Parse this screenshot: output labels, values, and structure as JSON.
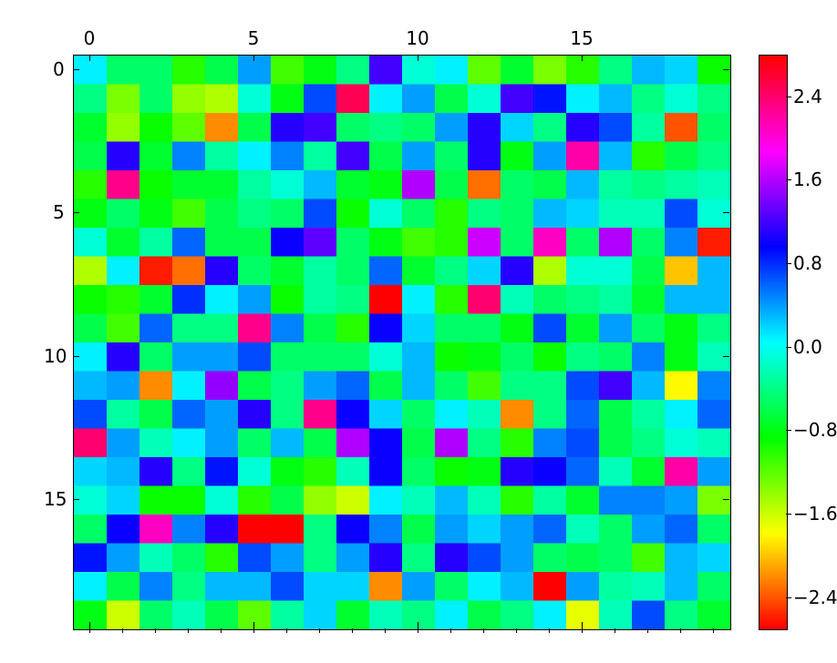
{
  "chart_data": {
    "type": "heatmap",
    "title": "",
    "xlabel": "",
    "ylabel": "",
    "x_ticks": [
      0,
      5,
      10,
      15
    ],
    "y_ticks": [
      0,
      5,
      10,
      15
    ],
    "colorbar_ticks": [
      -2.4,
      -1.6,
      -0.8,
      0.0,
      0.8,
      1.6,
      2.4
    ],
    "vmin": -2.7,
    "vmax": 2.8,
    "n_rows": 20,
    "n_cols": 20,
    "colormap": "hsv",
    "tick_labels": {
      "x0": "0",
      "x5": "5",
      "x10": "10",
      "x15": "15",
      "y0": "0",
      "y5": "5",
      "y10": "10",
      "y15": "15",
      "cb_m24": "−2.4",
      "cb_m16": "−1.6",
      "cb_m08": "−0.8",
      "cb_00": "0.0",
      "cb_08": "0.8",
      "cb_16": "1.6",
      "cb_24": "2.4"
    },
    "values": [
      [
        0.1,
        -0.5,
        -0.5,
        -1.0,
        -0.6,
        0.4,
        -1.1,
        -0.8,
        -0.4,
        1.2,
        -0.1,
        0.1,
        -1.2,
        -0.7,
        -1.3,
        -1.0,
        -0.4,
        0.3,
        0.2,
        -0.9
      ],
      [
        -0.4,
        -1.3,
        -0.5,
        -1.4,
        -1.5,
        -0.1,
        -0.8,
        0.7,
        2.5,
        0.1,
        0.4,
        -0.6,
        -0.1,
        1.2,
        0.9,
        0.1,
        0.3,
        -0.4,
        -0.1,
        -0.4
      ],
      [
        -0.7,
        -1.4,
        -0.9,
        -1.2,
        -2.2,
        -0.6,
        1.1,
        1.2,
        -0.5,
        -0.4,
        -0.5,
        0.4,
        1.1,
        0.2,
        -0.4,
        1.1,
        0.7,
        -0.3,
        -2.4,
        -0.5
      ],
      [
        -0.6,
        1.1,
        -0.7,
        0.5,
        -0.3,
        0.1,
        0.5,
        -0.3,
        1.2,
        -0.6,
        0.4,
        -0.5,
        1.1,
        -0.8,
        0.4,
        2.2,
        0.3,
        -1.0,
        -0.6,
        -0.4
      ],
      [
        -1.0,
        2.3,
        -0.9,
        -0.7,
        -0.7,
        -0.3,
        -0.1,
        0.3,
        -0.7,
        -0.8,
        1.6,
        -0.6,
        -2.3,
        -0.5,
        -0.6,
        0.3,
        -0.3,
        -0.4,
        -0.3,
        -0.2
      ],
      [
        -0.8,
        -0.5,
        -0.8,
        -1.1,
        -0.6,
        -0.4,
        -0.5,
        0.7,
        -0.9,
        -0.1,
        -0.5,
        -1.0,
        -0.4,
        -0.5,
        0.3,
        0.2,
        -0.2,
        -0.2,
        0.7,
        -0.1
      ],
      [
        -0.1,
        -0.7,
        -0.3,
        0.6,
        -0.6,
        -0.6,
        1.0,
        1.3,
        -0.5,
        -0.8,
        -1.1,
        -1.0,
        1.7,
        -0.5,
        2.1,
        -0.5,
        1.6,
        -0.5,
        0.5,
        -2.6
      ],
      [
        -1.5,
        0.1,
        -2.6,
        -2.3,
        1.1,
        -0.5,
        -0.7,
        -0.3,
        -0.5,
        0.6,
        -0.7,
        -0.4,
        0.2,
        1.1,
        -1.5,
        -0.1,
        -0.1,
        -0.6,
        -2.0,
        0.3
      ],
      [
        -0.9,
        -1.0,
        -0.7,
        0.8,
        0.1,
        0.4,
        -0.9,
        -0.3,
        -0.4,
        2.8,
        0.1,
        -1.0,
        2.4,
        -0.2,
        -0.5,
        -0.4,
        -0.3,
        -0.7,
        0.3,
        0.3
      ],
      [
        -0.6,
        -1.1,
        0.6,
        -0.4,
        -0.4,
        2.3,
        0.5,
        -0.6,
        -1.0,
        1.0,
        0.2,
        -0.5,
        -0.5,
        -0.8,
        0.7,
        -0.7,
        0.4,
        -0.5,
        -0.8,
        -0.4
      ],
      [
        0.1,
        1.1,
        -0.5,
        0.4,
        0.4,
        0.7,
        -0.5,
        -0.5,
        -0.5,
        -0.1,
        0.3,
        -0.9,
        -0.8,
        -0.5,
        -0.9,
        -0.4,
        -0.5,
        0.5,
        -0.8,
        -0.2
      ],
      [
        0.3,
        0.4,
        -2.2,
        0.1,
        1.5,
        -0.6,
        -0.4,
        0.4,
        0.6,
        -0.6,
        0.3,
        -0.5,
        -1.1,
        -0.4,
        -0.4,
        0.7,
        1.2,
        0.3,
        -1.8,
        0.5
      ],
      [
        0.7,
        -0.3,
        -0.6,
        0.6,
        0.4,
        1.1,
        -0.4,
        2.3,
        1.0,
        0.2,
        -0.5,
        0.1,
        -0.2,
        -2.2,
        -0.4,
        0.6,
        -0.6,
        -0.3,
        0.1,
        0.6
      ],
      [
        2.4,
        0.4,
        -0.2,
        0.1,
        0.4,
        -0.5,
        0.3,
        -0.6,
        1.6,
        1.0,
        -0.6,
        1.6,
        -0.4,
        -1.0,
        0.5,
        0.7,
        -0.6,
        -0.4,
        -0.1,
        -0.2
      ],
      [
        0.2,
        0.3,
        1.1,
        -0.4,
        0.9,
        -0.1,
        -0.8,
        -1.0,
        -0.2,
        1.0,
        -0.5,
        -0.9,
        -0.8,
        1.1,
        1.0,
        0.6,
        -0.2,
        -0.7,
        2.2,
        0.4
      ],
      [
        -0.1,
        0.2,
        -0.9,
        -0.9,
        -0.1,
        -1.0,
        -0.6,
        -1.4,
        -1.6,
        0.1,
        -0.2,
        0.3,
        -0.2,
        -1.0,
        -0.3,
        -0.7,
        0.5,
        0.5,
        0.4,
        -1.3
      ],
      [
        -0.5,
        1.0,
        2.1,
        0.5,
        1.1,
        -2.7,
        -2.7,
        -0.4,
        1.0,
        0.5,
        -0.6,
        0.4,
        0.2,
        0.4,
        0.6,
        -0.2,
        -0.5,
        0.4,
        0.6,
        -0.5
      ],
      [
        0.9,
        0.4,
        -0.2,
        -0.5,
        -1.0,
        0.7,
        0.4,
        -0.4,
        0.4,
        1.1,
        -0.4,
        1.1,
        0.7,
        0.4,
        -0.5,
        -0.6,
        -0.5,
        -1.1,
        0.3,
        0.2
      ],
      [
        0.1,
        -0.6,
        0.5,
        -0.4,
        0.3,
        0.3,
        0.7,
        0.2,
        0.2,
        -2.2,
        0.4,
        -0.5,
        0.1,
        0.3,
        -2.7,
        0.4,
        -0.3,
        -0.2,
        0.3,
        -0.5
      ],
      [
        -0.8,
        -1.6,
        -0.5,
        -0.2,
        -0.6,
        -1.2,
        -0.3,
        0.2,
        -0.7,
        -0.2,
        -0.4,
        0.1,
        -0.6,
        -0.4,
        0.1,
        -1.7,
        -0.2,
        0.7,
        -0.4,
        -0.7
      ]
    ]
  }
}
